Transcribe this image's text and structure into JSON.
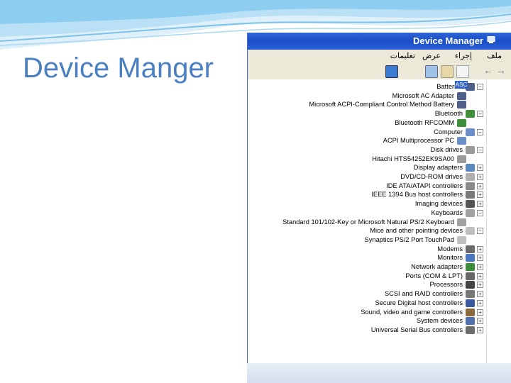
{
  "slide": {
    "title": "Device Manger"
  },
  "window": {
    "title": "Device Manager",
    "title_icon": "computer-icon",
    "menu": [
      "ملف",
      "إجراء",
      "عرض",
      "تعليمات"
    ],
    "toolbar": [
      "back-arrow-icon",
      "forward-arrow-icon",
      "properties-icon",
      "print-icon",
      "help-icon",
      "refresh-icon"
    ],
    "selected_node": "ASC"
  },
  "tree": [
    {
      "label": "Batteries",
      "icon": "battery-icon",
      "expander": "-",
      "level": 0
    },
    {
      "label": "Microsoft AC Adapter",
      "icon": "battery-icon",
      "expander": "",
      "level": 1
    },
    {
      "label": "Microsoft ACPI-Compliant Control Method Battery",
      "icon": "battery-icon",
      "expander": "",
      "level": 1
    },
    {
      "label": "Bluetooth",
      "icon": "bluetooth-icon",
      "expander": "-",
      "level": 0
    },
    {
      "label": "Bluetooth RFCOMM",
      "icon": "bluetooth-icon",
      "expander": "",
      "level": 1
    },
    {
      "label": "Computer",
      "icon": "computer-icon",
      "expander": "-",
      "level": 0
    },
    {
      "label": "ACPI Multiprocessor PC",
      "icon": "computer-icon",
      "expander": "",
      "level": 1
    },
    {
      "label": "Disk drives",
      "icon": "disk-icon",
      "expander": "-",
      "level": 0
    },
    {
      "label": "Hitachi HTS54252EK9SA00",
      "icon": "disk-icon",
      "expander": "",
      "level": 1
    },
    {
      "label": "Display adapters",
      "icon": "display-icon",
      "expander": "+",
      "level": 0
    },
    {
      "label": "DVD/CD-ROM drives",
      "icon": "cdrom-icon",
      "expander": "+",
      "level": 0
    },
    {
      "label": "IDE ATA/ATAPI controllers",
      "icon": "ide-icon",
      "expander": "+",
      "level": 0
    },
    {
      "label": "IEEE 1394 Bus host controllers",
      "icon": "ieee-icon",
      "expander": "+",
      "level": 0
    },
    {
      "label": "Imaging devices",
      "icon": "camera-icon",
      "expander": "+",
      "level": 0
    },
    {
      "label": "Keyboards",
      "icon": "keyboard-icon",
      "expander": "-",
      "level": 0
    },
    {
      "label": "Standard 101/102-Key or Microsoft Natural PS/2 Keyboard",
      "icon": "keyboard-icon",
      "expander": "",
      "level": 1
    },
    {
      "label": "Mice and other pointing devices",
      "icon": "mouse-icon",
      "expander": "-",
      "level": 0
    },
    {
      "label": "Synaptics PS/2 Port TouchPad",
      "icon": "mouse-icon",
      "expander": "",
      "level": 1
    },
    {
      "label": "Modems",
      "icon": "modem-icon",
      "expander": "+",
      "level": 0
    },
    {
      "label": "Monitors",
      "icon": "monitor-icon",
      "expander": "+",
      "level": 0
    },
    {
      "label": "Network adapters",
      "icon": "network-icon",
      "expander": "+",
      "level": 0
    },
    {
      "label": "Ports (COM & LPT)",
      "icon": "port-icon",
      "expander": "+",
      "level": 0
    },
    {
      "label": "Processors",
      "icon": "processor-icon",
      "expander": "+",
      "level": 0
    },
    {
      "label": "SCSI and RAID controllers",
      "icon": "scsi-icon",
      "expander": "+",
      "level": 0
    },
    {
      "label": "Secure Digital host controllers",
      "icon": "sd-icon",
      "expander": "+",
      "level": 0
    },
    {
      "label": "Sound, video and game controllers",
      "icon": "sound-icon",
      "expander": "+",
      "level": 0
    },
    {
      "label": "System devices",
      "icon": "system-icon",
      "expander": "+",
      "level": 0
    },
    {
      "label": "Universal Serial Bus controllers",
      "icon": "usb-icon",
      "expander": "+",
      "level": 0
    }
  ],
  "colors": {
    "title_text": "#4a7fc2",
    "titlebar": "#1a4ec7",
    "menubar": "#ece9d8",
    "selection": "#3164c9"
  }
}
